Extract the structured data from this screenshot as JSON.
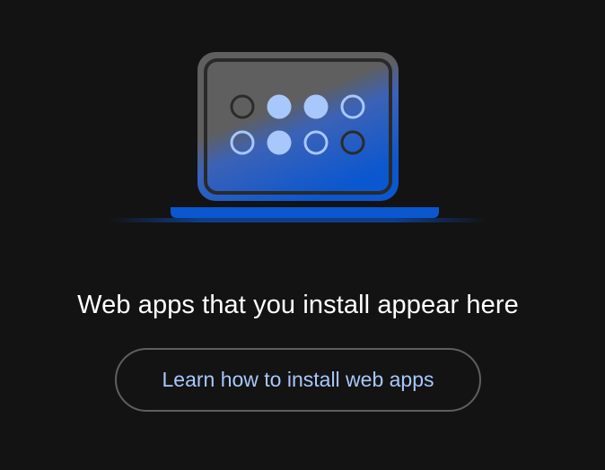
{
  "empty_state": {
    "illustration_icon": "laptop-app-grid-icon",
    "title": "Web apps that you install appear here",
    "learn_button_label": "Learn how to install web apps"
  },
  "colors": {
    "background": "#131313",
    "accent": "#a8c7fa",
    "laptop_blue": "#0b57d0",
    "button_border": "#5d5f61"
  }
}
